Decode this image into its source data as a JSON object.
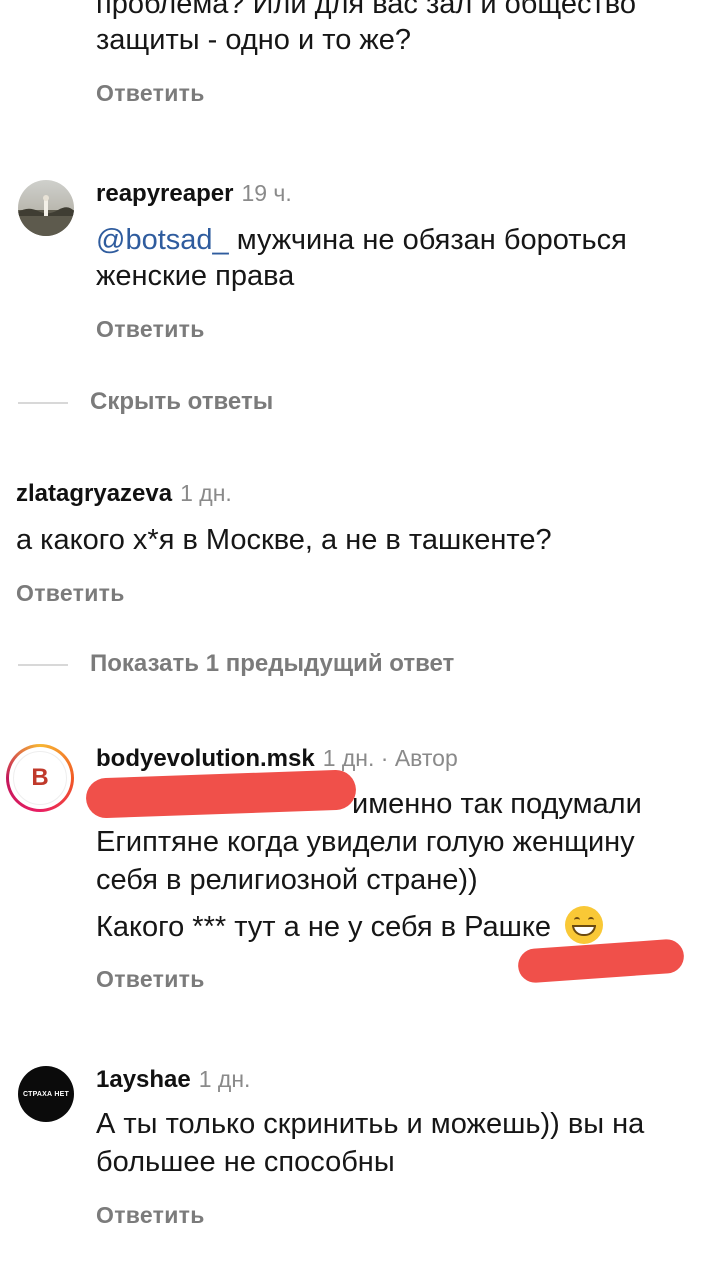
{
  "comment0": {
    "line1": "проблема? Или для вас зал и общество",
    "line2": "защиты - одно и то же?",
    "reply": "Ответить"
  },
  "comment1": {
    "username": "reapyreaper",
    "time": "19 ч.",
    "mention": "@botsad_",
    "line1": " мужчина не обязан бороться",
    "line2": "женские права",
    "reply": "Ответить"
  },
  "hide_replies": "Скрыть ответы",
  "comment2": {
    "username": "zlatagryazeva",
    "time": "1 дн.",
    "line1": "а какого х*я в Москве, а не в ташкенте?",
    "reply": "Ответить"
  },
  "show_previous": "Показать 1 предыдущий ответ",
  "comment3": {
    "username": "bodyevolution.msk",
    "time": "1 дн. · Автор",
    "avatar_letter": "B",
    "line1": "именно так подумали",
    "line2": "Египтяне когда увидели голую женщину",
    "line3": "себя в религиозной стране))",
    "line4": "Какого *** тут а не у себя в Рашке",
    "emoji": "😁",
    "reply": "Ответить"
  },
  "comment4": {
    "username": "1ayshae",
    "time": "1 дн.",
    "avatar_text": "СТРАХА НЕТ",
    "line1": "А ты только скринитьь и можешь)) вы на",
    "line2": "большее не способны",
    "reply": "Ответить"
  },
  "colors": {
    "redaction": "#f0504a",
    "mention": "#2f5c9e",
    "muted": "#7b7b7b"
  }
}
